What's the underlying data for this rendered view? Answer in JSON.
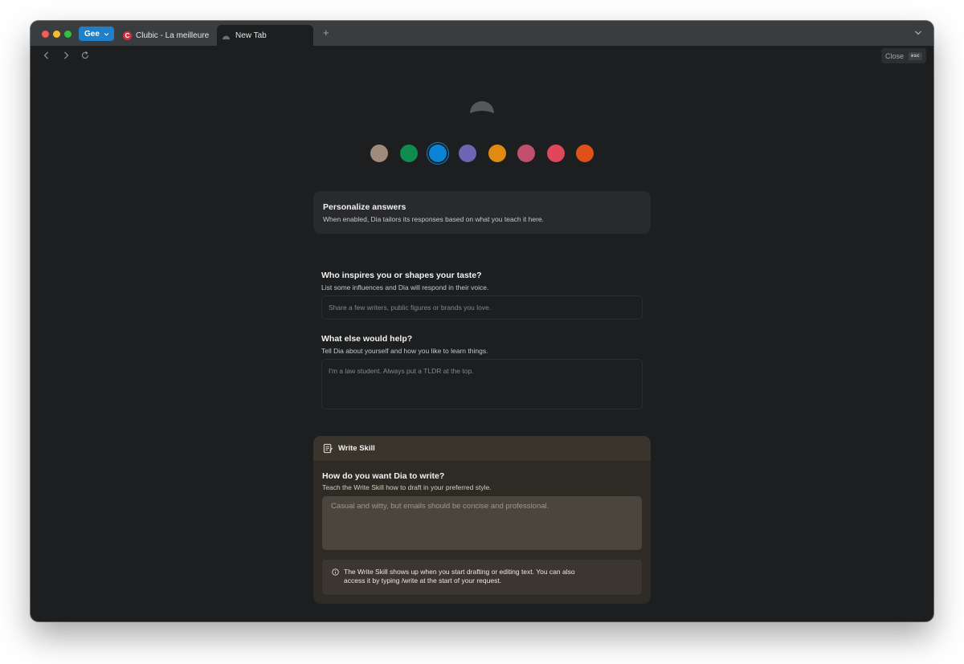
{
  "browser": {
    "profile_label": "Gee",
    "tabs": [
      {
        "title": "Clubic - La meilleure sou",
        "favicon_letter": "C"
      },
      {
        "title": "New Tab"
      }
    ],
    "new_tab_symbol": "+",
    "close_label": "Close",
    "close_shortcut": "esc"
  },
  "colors": {
    "swatches": [
      "#a08a7c",
      "#0f8b4e",
      "#0a84d6",
      "#6e64b4",
      "#e08a12",
      "#c0506e",
      "#e0475a",
      "#e0501a"
    ],
    "selected_swatch_index": 2,
    "profile_accent": "#1f7fc9"
  },
  "personalize": {
    "title": "Personalize answers",
    "subtitle": "When enabled, Dia tailors its responses based on what you teach it here."
  },
  "inspires": {
    "title": "Who inspires you or shapes your taste?",
    "subtitle": "List some influences and Dia will respond in their voice.",
    "placeholder": "Share a few writers, public figures or brands you love."
  },
  "help": {
    "title": "What else would help?",
    "subtitle": "Tell Dia about yourself and how you like to learn things.",
    "placeholder": "I'm a law student. Always put a TLDR at the top."
  },
  "write_skill": {
    "header": "Write Skill",
    "title": "How do you want Dia to write?",
    "subtitle": "Teach the Write Skill how to draft in your preferred style.",
    "placeholder": "Casual and witty, but emails should be concise and professional.",
    "info_line1": "The Write Skill shows up when you start drafting or editing text. You can also",
    "info_line2": "access it by typing /write at the start of your request."
  }
}
